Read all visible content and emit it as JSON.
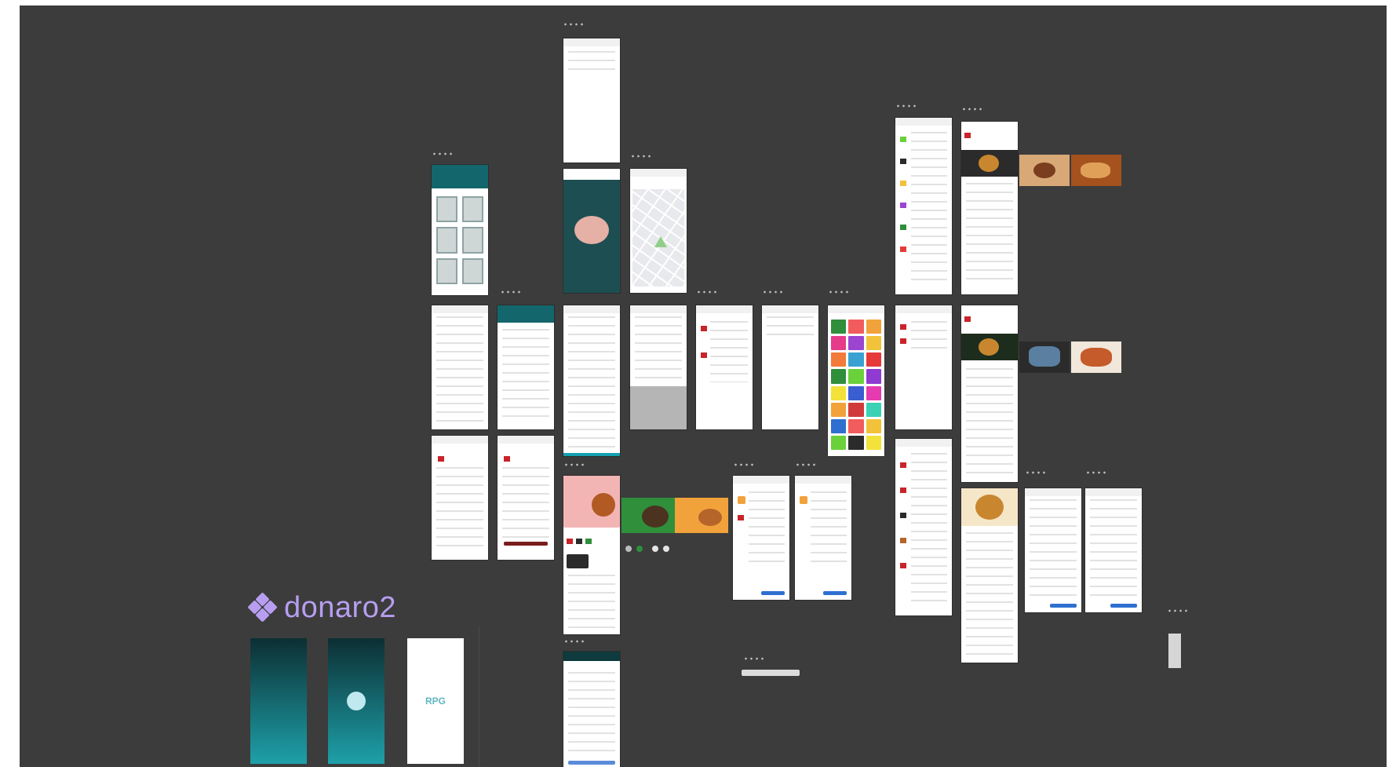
{
  "canvas": {
    "background": "#3c3c3c",
    "frame_label": "• • •"
  },
  "brand": {
    "name": "donaro2",
    "icon": "diamond-cluster-icon",
    "color": "#b79ef0"
  },
  "splash_screens": [
    {
      "name": "splash-gradient"
    },
    {
      "name": "splash-with-logo-circle"
    },
    {
      "name": "splash-white-logo",
      "logo_text": "RPG"
    }
  ],
  "colors": {
    "teal": "#13666b",
    "promo_green": "#2f8f3b",
    "promo_orange": "#f2a23a",
    "accent_red": "#c8242a",
    "accent_blue": "#2f6fd0"
  }
}
